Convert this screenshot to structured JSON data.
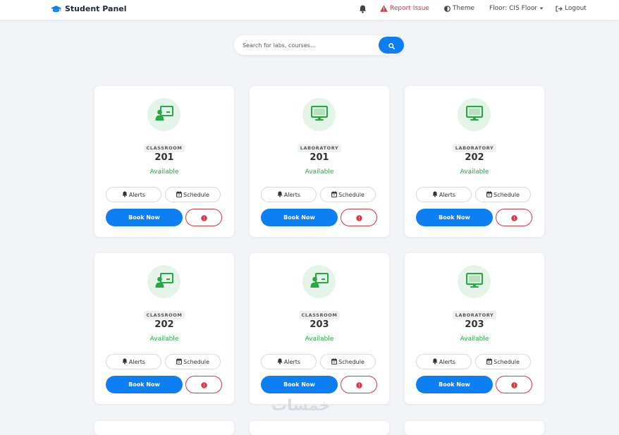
{
  "navbar": {
    "brand": "Student Panel",
    "brand_icon": "graduation-cap-icon",
    "bell_icon": "bell-icon",
    "report_label": "Report Issue",
    "theme_label": "Theme",
    "floor_label": "Floor: CIS Floor",
    "logout_label": "Logout"
  },
  "search": {
    "placeholder": "Search for labs, courses...",
    "value": ""
  },
  "colors": {
    "primary": "#0d7ff2",
    "success": "#28a745",
    "danger": "#dc3545",
    "icon_green": "#28a745"
  },
  "card_labels": {
    "alerts": "Alerts",
    "schedule": "Schedule",
    "book": "Book Now"
  },
  "rooms": [
    {
      "type": "CLASSROOM",
      "number": "201",
      "status": "Available",
      "icon": "classroom-icon"
    },
    {
      "type": "LABORATORY",
      "number": "201",
      "status": "Available",
      "icon": "desktop-icon"
    },
    {
      "type": "LABORATORY",
      "number": "202",
      "status": "Available",
      "icon": "desktop-icon"
    },
    {
      "type": "CLASSROOM",
      "number": "202",
      "status": "Available",
      "icon": "classroom-icon"
    },
    {
      "type": "CLASSROOM",
      "number": "203",
      "status": "Available",
      "icon": "classroom-icon"
    },
    {
      "type": "LABORATORY",
      "number": "203",
      "status": "Available",
      "icon": "desktop-icon"
    }
  ],
  "watermark": "خمسات"
}
